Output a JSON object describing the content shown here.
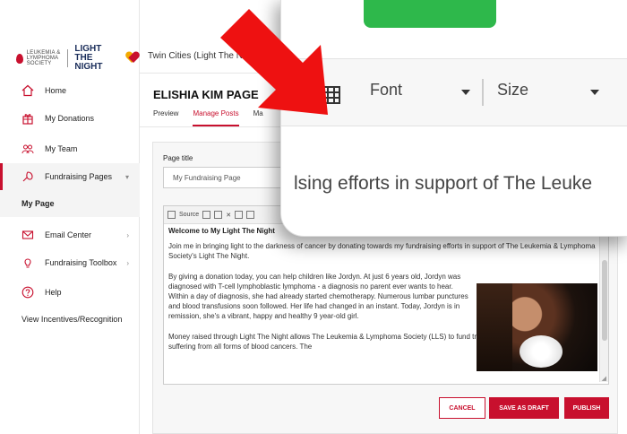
{
  "logo": {
    "lls_text": "LEUKEMIA & LYMPHOMA SOCIETY",
    "ltn_line1": "LIGHT",
    "ltn_line2": "THE NIGHT"
  },
  "header": {
    "event_title": "Twin Cities (Light The N"
  },
  "sidebar": {
    "items": [
      {
        "label": "Home",
        "icon": "home-icon"
      },
      {
        "label": "My Donations",
        "icon": "gift-icon"
      },
      {
        "label": "My Team",
        "icon": "team-icon"
      },
      {
        "label": "Fundraising Pages",
        "icon": "fundraising-icon"
      },
      {
        "label": "Email Center",
        "icon": "email-icon"
      },
      {
        "label": "Fundraising Toolbox",
        "icon": "lightbulb-icon"
      },
      {
        "label": "Help",
        "icon": "help-icon"
      }
    ],
    "sub_item": "My Page",
    "footer_link": "View Incentives/Recognition"
  },
  "page": {
    "heading": "ELISHIA KIM PAGE",
    "tabs": [
      "Preview",
      "Manage Posts",
      "Ma"
    ],
    "active_tab": "Manage Posts"
  },
  "form": {
    "title_label": "Page title",
    "title_value": "My Fundraising Page"
  },
  "editor": {
    "toolbar_source": "Source",
    "heading": "Welcome to My Light The Night",
    "paragraphs": [
      "Join me in bringing light to the darkness of cancer by donating towards my fundraising efforts in support of The Leukemia & Lymphoma Society's Light The Night.",
      "By giving a donation today, you can help children like Jordyn. At just 6 years old, Jordyn was diagnosed with T-cell lymphoblastic lymphoma - a diagnosis no parent ever wants to hear. Within a day of diagnosis, she had already started chemotherapy. Numerous lumbar punctures and blood transfusions soon followed. Her life had changed in an instant. Today, Jordyn is in remission, she's a vibrant, happy and healthy 9 year-old girl.",
      "Money raised through Light The Night allows The Leukemia & Lymphoma Society (LLS) to fund treatments for patients who are suffering from all forms of blood cancers. The"
    ]
  },
  "actions": {
    "cancel": "CANCEL",
    "save_draft": "SAVE AS DRAFT",
    "publish": "PUBLISH"
  },
  "zoom": {
    "font_label": "Font",
    "size_label": "Size",
    "text_fragment": "lsing efforts in support of The Leuke"
  },
  "colors": {
    "brand_red": "#c8102e",
    "green_button": "#2eb84b",
    "arrow_red": "#ee1111"
  }
}
